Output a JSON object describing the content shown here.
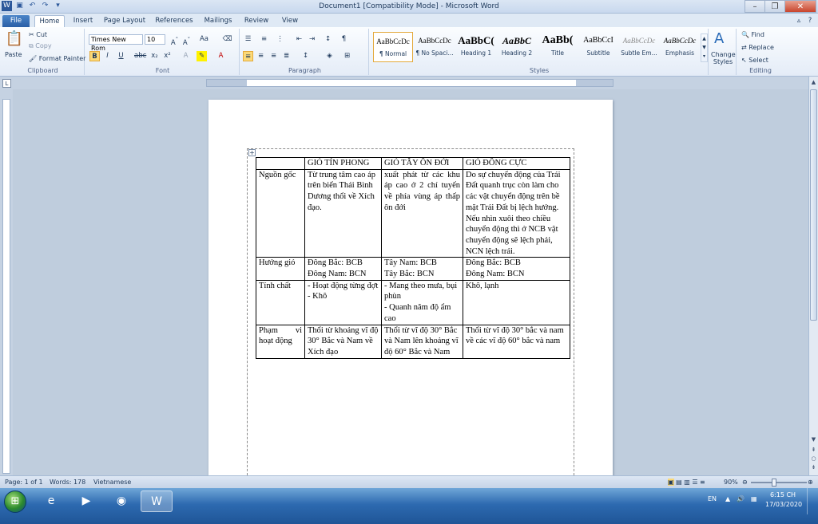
{
  "window": {
    "title": "Document1 [Compatibility Mode] - Microsoft Word"
  },
  "tabs": [
    "File",
    "Home",
    "Insert",
    "Page Layout",
    "References",
    "Mailings",
    "Review",
    "View"
  ],
  "clipboard": {
    "paste": "Paste",
    "cut": "Cut",
    "copy": "Copy",
    "format_painter": "Format Painter",
    "label": "Clipboard"
  },
  "font": {
    "name": "Times New Rom",
    "size": "10",
    "label": "Font"
  },
  "paragraph": {
    "label": "Paragraph"
  },
  "styles": {
    "label": "Styles",
    "items": [
      {
        "preview": "AaBbCcDc",
        "name": "¶ Normal"
      },
      {
        "preview": "AaBbCcDc",
        "name": "¶ No Spaci..."
      },
      {
        "preview": "AaBbC(",
        "name": "Heading 1"
      },
      {
        "preview": "AaBbC",
        "name": "Heading 2"
      },
      {
        "preview": "AaBb(",
        "name": "Title"
      },
      {
        "preview": "AaBbCcI",
        "name": "Subtitle"
      },
      {
        "preview": "AaBbCcDc",
        "name": "Subtle Em..."
      },
      {
        "preview": "AaBbCcDc",
        "name": "Emphasis"
      }
    ],
    "change_styles": "Change Styles"
  },
  "editing": {
    "find": "Find",
    "replace": "Replace",
    "select": "Select",
    "label": "Editing"
  },
  "table": {
    "header": [
      "",
      "GIÓ TÍN PHONG",
      "GIÓ TÂY ÔN ĐỚI",
      "GIÓ ĐÔNG CỰC"
    ],
    "rows": [
      [
        "Nguồn gốc",
        "Từ trung tâm cao áp trên biển Thái Bình Dương thổi về Xích đạo.",
        "xuất phát từ các khu áp cao ở 2 chí tuyến về phía vùng áp thấp ôn đới",
        "Do sự chuyển động của Trái Đất quanh trục còn làm cho các vật chuyển động trên bề mặt Trái Đất bị lệch hướng. Nếu nhìn xuôi theo chiều chuyển động thì ở NCB vật chuyển động sẽ lệch phải, NCN lệch trái."
      ],
      [
        "Hướng gió",
        "Đông Bắc: BCB\nĐông Nam: BCN",
        "Tây Nam: BCB\nTây Bắc: BCN",
        "Đông Bắc: BCB\nĐông Nam: BCN"
      ],
      [
        "Tính chất",
        "- Hoạt động từng đợt\n- Khô",
        "- Mang theo mưa, bụi phùn\n- Quanh năm độ ẩm cao",
        "Khô, lạnh"
      ],
      [
        "Phạm vi hoạt động",
        "Thổi từ khoảng vĩ độ 30° Bắc và Nam về Xích đạo",
        "Thổi từ vĩ độ 30° Bắc và Nam lên khoảng vĩ độ 60° Bắc và Nam",
        "Thổi từ vĩ độ 30° bắc và nam về các vĩ độ 60° bắc và nam"
      ]
    ]
  },
  "statusbar": {
    "page": "Page: 1 of 1",
    "words": "Words: 178",
    "language": "Vietnamese",
    "zoom": "90%"
  },
  "taskbar": {
    "lang": "EN",
    "time": "6:15 CH",
    "date": "17/03/2020"
  }
}
